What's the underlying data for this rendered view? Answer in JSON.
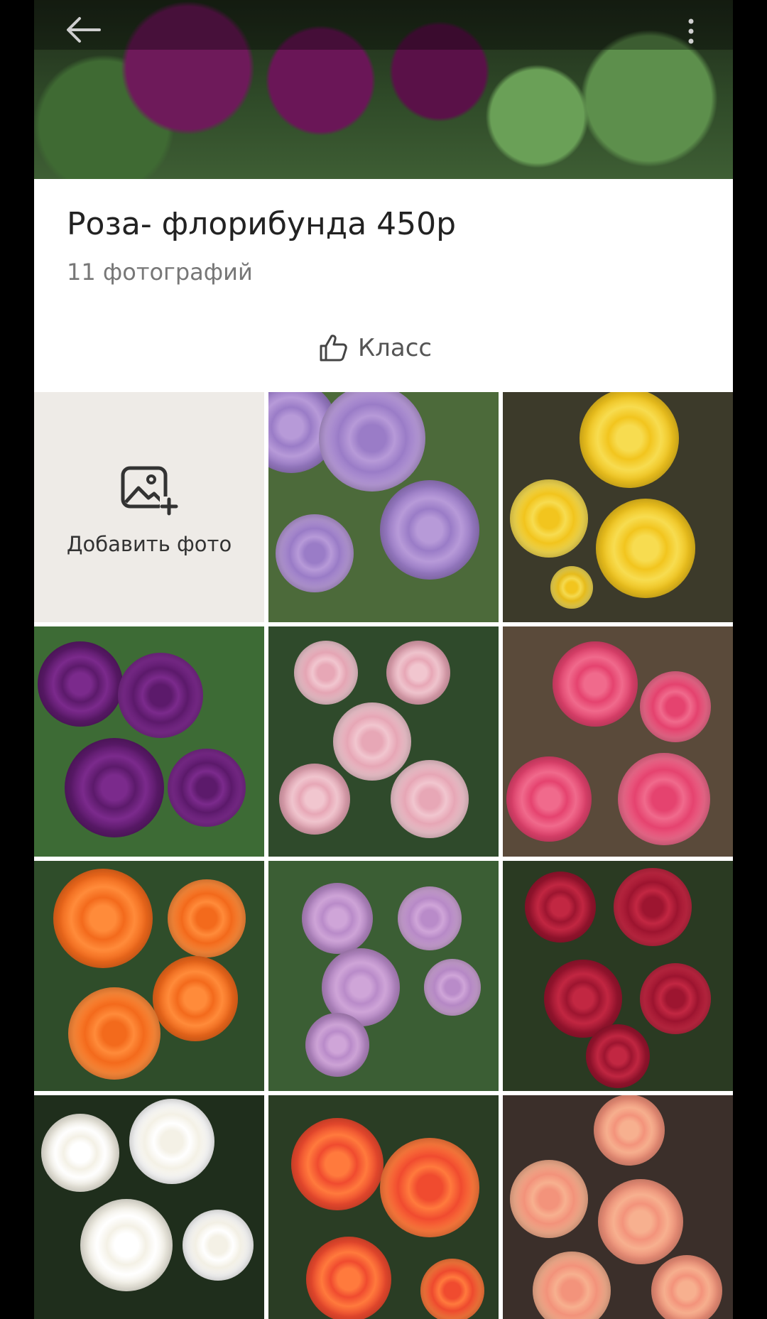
{
  "topbar": {
    "back_icon": "arrow-left-icon",
    "more_icon": "more-vertical-icon"
  },
  "album": {
    "title": "Роза- флорибунда 450р",
    "photo_count": "11 фотографий",
    "like_label": "Класс",
    "like_icon": "thumbs-up-icon"
  },
  "add_photo": {
    "label": "Добавить фото",
    "icon": "add-image-icon"
  },
  "photos": [
    {
      "subject": "lavender roses",
      "colors": [
        "#9a7cc7",
        "#b79ad8",
        "#4c6a3a"
      ]
    },
    {
      "subject": "yellow roses",
      "colors": [
        "#f2c51e",
        "#f7dc50",
        "#3c3a2a"
      ]
    },
    {
      "subject": "purple roses",
      "colors": [
        "#5c1a6b",
        "#7b2a8c",
        "#3d6b35"
      ]
    },
    {
      "subject": "pale pink roses",
      "colors": [
        "#f1c6cf",
        "#e7a7b6",
        "#2f4a2b"
      ]
    },
    {
      "subject": "pink peony roses",
      "colors": [
        "#e5436f",
        "#f06a8c",
        "#5a4a3a"
      ]
    },
    {
      "subject": "orange roses",
      "colors": [
        "#f36a1c",
        "#ff8b3a",
        "#2f4d2a"
      ]
    },
    {
      "subject": "lilac cluster roses",
      "colors": [
        "#b98bc9",
        "#cfa5d8",
        "#3b5e34"
      ]
    },
    {
      "subject": "dark red roses",
      "colors": [
        "#9d1530",
        "#c22742",
        "#2a3a22"
      ]
    },
    {
      "subject": "white roses",
      "colors": [
        "#f4f1e6",
        "#ffffff",
        "#1f2e1c"
      ]
    },
    {
      "subject": "coral red roses",
      "colors": [
        "#f04b2f",
        "#ff7a3d",
        "#2a3d24"
      ]
    },
    {
      "subject": "salmon roses",
      "colors": [
        "#f3937b",
        "#f7b08f",
        "#3b2f2a"
      ]
    }
  ],
  "colors": {
    "background": "#000000",
    "surface": "#ffffff",
    "add_tile": "#eeebe7",
    "text_primary": "#222222",
    "text_secondary": "#777777"
  }
}
